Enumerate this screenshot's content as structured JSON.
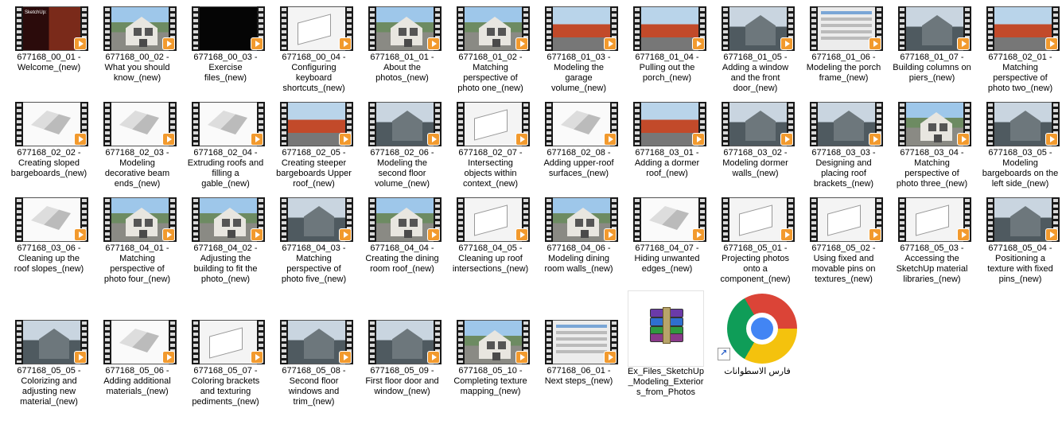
{
  "files": [
    {
      "name": "677168_00_01 - Welcome_(new)",
      "lines": [
        "677168_00_01 -",
        "Welcome_(new)"
      ],
      "thumb": "intro"
    },
    {
      "name": "677168_00_02 - What you should know_(new)",
      "lines": [
        "677168_00_02 -",
        "What you should",
        "know_(new)"
      ],
      "thumb": "house"
    },
    {
      "name": "677168_00_03 - Exercise files_(new)",
      "lines": [
        "677168_00_03 -",
        "Exercise",
        "files_(new)"
      ],
      "thumb": "black"
    },
    {
      "name": "677168_00_04 - Configuring keyboard shortcuts_(new)",
      "lines": [
        "677168_00_04 -",
        "Configuring",
        "keyboard",
        "shortcuts_(new)"
      ],
      "thumb": "white"
    },
    {
      "name": "677168_01_01 - About the photos_(new)",
      "lines": [
        "677168_01_01 -",
        "About the",
        "photos_(new)"
      ],
      "thumb": "house"
    },
    {
      "name": "677168_01_02 - Matching perspective of photo one_(new)",
      "lines": [
        "677168_01_02 -",
        "Matching",
        "perspective of",
        "photo one_(new)"
      ],
      "thumb": "house"
    },
    {
      "name": "677168_01_03 - Modeling the garage volume_(new)",
      "lines": [
        "677168_01_03 -",
        "Modeling the",
        "garage",
        "volume_(new)"
      ],
      "thumb": "tree"
    },
    {
      "name": "677168_01_04 - Pulling out the porch_(new)",
      "lines": [
        "677168_01_04 -",
        "Pulling out the",
        "porch_(new)"
      ],
      "thumb": "tree"
    },
    {
      "name": "677168_01_05 - Adding a window and the front door_(new)",
      "lines": [
        "677168_01_05 -",
        "Adding a window",
        "and the front",
        "door_(new)"
      ],
      "thumb": "gray"
    },
    {
      "name": "677168_01_06 - Modeling the porch frame_(new)",
      "lines": [
        "677168_01_06 -",
        "Modeling the porch",
        "frame_(new)"
      ],
      "thumb": "ui"
    },
    {
      "name": "677168_01_07 - Building columns on piers_(new)",
      "lines": [
        "677168_01_07 -",
        "Building columns on",
        "piers_(new)"
      ],
      "thumb": "gray"
    },
    {
      "name": "677168_02_01 - Matching perspective of photo two_(new)",
      "lines": [
        "677168_02_01 -",
        "Matching",
        "perspective of",
        "photo two_(new)"
      ],
      "thumb": "tree"
    },
    {
      "name": "677168_02_02 - Creating sloped bargeboards_(new)",
      "lines": [
        "677168_02_02 -",
        "Creating sloped",
        "bargeboards_(new)"
      ],
      "thumb": "sketch"
    },
    {
      "name": "677168_02_03 - Modeling decorative beam ends_(new)",
      "lines": [
        "677168_02_03 -",
        "Modeling",
        "decorative beam",
        "ends_(new)"
      ],
      "thumb": "sketch"
    },
    {
      "name": "677168_02_04 - Extruding roofs and filling a gable_(new)",
      "lines": [
        "677168_02_04 -",
        "Extruding roofs and",
        "filling a",
        "gable_(new)"
      ],
      "thumb": "sketch"
    },
    {
      "name": "677168_02_05 - Creating steeper bargeboards Upper roof_(new)",
      "lines": [
        "677168_02_05 -",
        "Creating steeper",
        "bargeboards Upper",
        "roof_(new)"
      ],
      "thumb": "tree"
    },
    {
      "name": "677168_02_06 - Modeling the second floor volume_(new)",
      "lines": [
        "677168_02_06 -",
        "Modeling the",
        "second floor",
        "volume_(new)"
      ],
      "thumb": "gray"
    },
    {
      "name": "677168_02_07 - Intersecting objects within context_(new)",
      "lines": [
        "677168_02_07 -",
        "Intersecting",
        "objects within",
        "context_(new)"
      ],
      "thumb": "white"
    },
    {
      "name": "677168_02_08 - Adding upper-roof surfaces_(new)",
      "lines": [
        "677168_02_08 -",
        "Adding upper-roof",
        "surfaces_(new)"
      ],
      "thumb": "sketch"
    },
    {
      "name": "677168_03_01 - Adding a dormer roof_(new)",
      "lines": [
        "677168_03_01 -",
        "Adding a dormer",
        "roof_(new)"
      ],
      "thumb": "tree"
    },
    {
      "name": "677168_03_02 - Modeling dormer walls_(new)",
      "lines": [
        "677168_03_02 -",
        "Modeling dormer",
        "walls_(new)"
      ],
      "thumb": "gray"
    },
    {
      "name": "677168_03_03 - Designing and placing roof brackets_(new)",
      "lines": [
        "677168_03_03 -",
        "Designing and",
        "placing roof",
        "brackets_(new)"
      ],
      "thumb": "gray"
    },
    {
      "name": "677168_03_04 - Matching perspective of photo three_(new)",
      "lines": [
        "677168_03_04 -",
        "Matching",
        "perspective of",
        "photo three_(new)"
      ],
      "thumb": "house"
    },
    {
      "name": "677168_03_05 - Modeling bargeboards on the left side_(new)",
      "lines": [
        "677168_03_05 -",
        "Modeling",
        "bargeboards on the",
        "left side_(new)"
      ],
      "thumb": "gray"
    },
    {
      "name": "677168_03_06 - Cleaning up the roof slopes_(new)",
      "lines": [
        "677168_03_06 -",
        "Cleaning up the",
        "roof slopes_(new)"
      ],
      "thumb": "sketch"
    },
    {
      "name": "677168_04_01 - Matching perspective of photo four_(new)",
      "lines": [
        "677168_04_01 -",
        "Matching",
        "perspective of",
        "photo four_(new)"
      ],
      "thumb": "house"
    },
    {
      "name": "677168_04_02 - Adjusting the building to fit the photo_(new)",
      "lines": [
        "677168_04_02 -",
        "Adjusting the",
        "building to fit the",
        "photo_(new)"
      ],
      "thumb": "house"
    },
    {
      "name": "677168_04_03 - Matching perspective of photo five_(new)",
      "lines": [
        "677168_04_03 -",
        "Matching",
        "perspective of",
        "photo five_(new)"
      ],
      "thumb": "gray"
    },
    {
      "name": "677168_04_04 - Creating the dining room roof_(new)",
      "lines": [
        "677168_04_04 -",
        "Creating the dining",
        "room roof_(new)"
      ],
      "thumb": "house"
    },
    {
      "name": "677168_04_05 - Cleaning up roof intersections_(new)",
      "lines": [
        "677168_04_05 -",
        "Cleaning up roof",
        "intersections_(new)"
      ],
      "thumb": "white"
    },
    {
      "name": "677168_04_06 - Modeling dining room walls_(new)",
      "lines": [
        "677168_04_06 -",
        "Modeling dining",
        "room walls_(new)"
      ],
      "thumb": "house"
    },
    {
      "name": "677168_04_07 - Hiding unwanted edges_(new)",
      "lines": [
        "677168_04_07 -",
        "Hiding unwanted",
        "edges_(new)"
      ],
      "thumb": "sketch"
    },
    {
      "name": "677168_05_01 - Projecting photos onto a component_(new)",
      "lines": [
        "677168_05_01 -",
        "Projecting photos",
        "onto a",
        "component_(new)"
      ],
      "thumb": "white"
    },
    {
      "name": "677168_05_02 - Using fixed and movable pins on textures_(new)",
      "lines": [
        "677168_05_02 -",
        "Using fixed and",
        "movable pins on",
        "textures_(new)"
      ],
      "thumb": "white"
    },
    {
      "name": "677168_05_03 - Accessing the SketchUp material libraries_(new)",
      "lines": [
        "677168_05_03 -",
        "Accessing the",
        "SketchUp material",
        "libraries_(new)"
      ],
      "thumb": "white"
    },
    {
      "name": "677168_05_04 - Positioning a texture with fixed pins_(new)",
      "lines": [
        "677168_05_04 -",
        "Positioning a",
        "texture with fixed",
        "pins_(new)"
      ],
      "thumb": "gray"
    },
    {
      "name": "677168_05_05 - Colorizing and adjusting new material_(new)",
      "lines": [
        "677168_05_05 -",
        "Colorizing and",
        "adjusting new",
        "material_(new)"
      ],
      "thumb": "gray"
    },
    {
      "name": "677168_05_06 - Adding additional materials_(new)",
      "lines": [
        "677168_05_06 -",
        "Adding additional",
        "materials_(new)"
      ],
      "thumb": "sketch"
    },
    {
      "name": "677168_05_07 - Coloring brackets and texturing pediments_(new)",
      "lines": [
        "677168_05_07 -",
        "Coloring brackets",
        "and texturing",
        "pediments_(new)"
      ],
      "thumb": "white"
    },
    {
      "name": "677168_05_08 - Second floor windows and trim_(new)",
      "lines": [
        "677168_05_08 -",
        "Second floor",
        "windows and",
        "trim_(new)"
      ],
      "thumb": "gray"
    },
    {
      "name": "677168_05_09 - First floor door and window_(new)",
      "lines": [
        "677168_05_09 -",
        "First floor door and",
        "window_(new)"
      ],
      "thumb": "gray"
    },
    {
      "name": "677168_05_10 - Completing texture mapping_(new)",
      "lines": [
        "677168_05_10 -",
        "Completing texture",
        "mapping_(new)"
      ],
      "thumb": "house"
    },
    {
      "name": "677168_06_01 - Next steps_(new)",
      "lines": [
        "677168_06_01 -",
        "Next steps_(new)"
      ],
      "thumb": "ui"
    }
  ],
  "zip_file": {
    "name": "Ex_Files_SketchUp_Modeling_Exteriors_from_Photos",
    "lines": [
      "Ex_Files_SketchUp",
      "_Modeling_Exterior",
      "s_from_Photos"
    ],
    "icon": "winrar-archive-icon"
  },
  "shortcut": {
    "name": "فارس الاسطوانات",
    "icon": "chrome-icon"
  },
  "colors": {
    "play_badge": "#f29a2e",
    "selection_border": "#e5e5e5"
  }
}
